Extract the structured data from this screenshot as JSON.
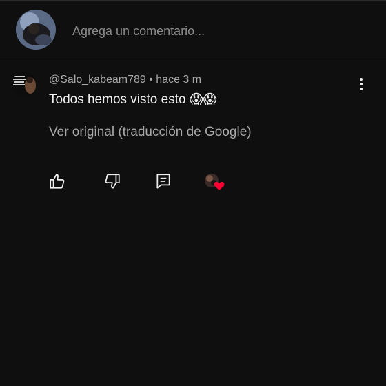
{
  "add_comment": {
    "placeholder": "Agrega un comentario..."
  },
  "comment": {
    "author": "@Salo_kabeam789",
    "time": "hace 3 m",
    "meta_separator": " • ",
    "text": "Todos hemos visto esto 😱😱",
    "translate_label": "Ver original (traducción de Google)"
  },
  "actions": {
    "like_icon": "thumbs-up-icon",
    "dislike_icon": "thumbs-down-icon",
    "reply_icon": "reply-icon",
    "heart_icon": "creator-heart-icon"
  },
  "colors": {
    "background": "#0f0f0f",
    "primary_text": "#f1f1f1",
    "secondary_text": "#a8a8a8",
    "heart": "#ff0033"
  }
}
